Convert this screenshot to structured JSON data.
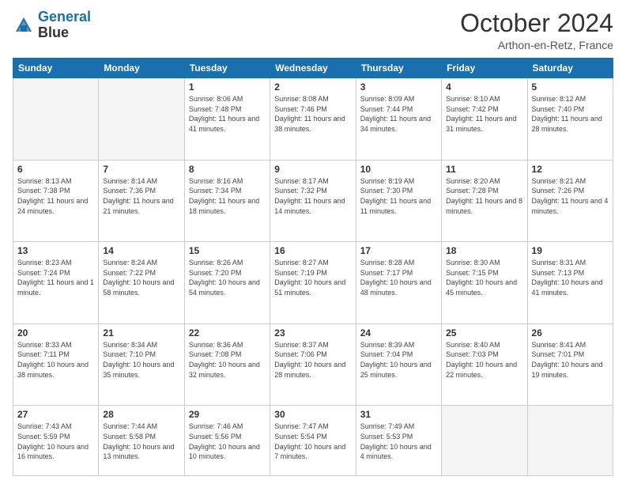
{
  "header": {
    "logo_line1": "General",
    "logo_line2": "Blue",
    "month": "October 2024",
    "location": "Arthon-en-Retz, France"
  },
  "weekdays": [
    "Sunday",
    "Monday",
    "Tuesday",
    "Wednesday",
    "Thursday",
    "Friday",
    "Saturday"
  ],
  "weeks": [
    [
      {
        "day": null
      },
      {
        "day": null
      },
      {
        "day": "1",
        "sunrise": "Sunrise: 8:06 AM",
        "sunset": "Sunset: 7:48 PM",
        "daylight": "Daylight: 11 hours and 41 minutes."
      },
      {
        "day": "2",
        "sunrise": "Sunrise: 8:08 AM",
        "sunset": "Sunset: 7:46 PM",
        "daylight": "Daylight: 11 hours and 38 minutes."
      },
      {
        "day": "3",
        "sunrise": "Sunrise: 8:09 AM",
        "sunset": "Sunset: 7:44 PM",
        "daylight": "Daylight: 11 hours and 34 minutes."
      },
      {
        "day": "4",
        "sunrise": "Sunrise: 8:10 AM",
        "sunset": "Sunset: 7:42 PM",
        "daylight": "Daylight: 11 hours and 31 minutes."
      },
      {
        "day": "5",
        "sunrise": "Sunrise: 8:12 AM",
        "sunset": "Sunset: 7:40 PM",
        "daylight": "Daylight: 11 hours and 28 minutes."
      }
    ],
    [
      {
        "day": "6",
        "sunrise": "Sunrise: 8:13 AM",
        "sunset": "Sunset: 7:38 PM",
        "daylight": "Daylight: 11 hours and 24 minutes."
      },
      {
        "day": "7",
        "sunrise": "Sunrise: 8:14 AM",
        "sunset": "Sunset: 7:36 PM",
        "daylight": "Daylight: 11 hours and 21 minutes."
      },
      {
        "day": "8",
        "sunrise": "Sunrise: 8:16 AM",
        "sunset": "Sunset: 7:34 PM",
        "daylight": "Daylight: 11 hours and 18 minutes."
      },
      {
        "day": "9",
        "sunrise": "Sunrise: 8:17 AM",
        "sunset": "Sunset: 7:32 PM",
        "daylight": "Daylight: 11 hours and 14 minutes."
      },
      {
        "day": "10",
        "sunrise": "Sunrise: 8:19 AM",
        "sunset": "Sunset: 7:30 PM",
        "daylight": "Daylight: 11 hours and 11 minutes."
      },
      {
        "day": "11",
        "sunrise": "Sunrise: 8:20 AM",
        "sunset": "Sunset: 7:28 PM",
        "daylight": "Daylight: 11 hours and 8 minutes."
      },
      {
        "day": "12",
        "sunrise": "Sunrise: 8:21 AM",
        "sunset": "Sunset: 7:26 PM",
        "daylight": "Daylight: 11 hours and 4 minutes."
      }
    ],
    [
      {
        "day": "13",
        "sunrise": "Sunrise: 8:23 AM",
        "sunset": "Sunset: 7:24 PM",
        "daylight": "Daylight: 11 hours and 1 minute."
      },
      {
        "day": "14",
        "sunrise": "Sunrise: 8:24 AM",
        "sunset": "Sunset: 7:22 PM",
        "daylight": "Daylight: 10 hours and 58 minutes."
      },
      {
        "day": "15",
        "sunrise": "Sunrise: 8:26 AM",
        "sunset": "Sunset: 7:20 PM",
        "daylight": "Daylight: 10 hours and 54 minutes."
      },
      {
        "day": "16",
        "sunrise": "Sunrise: 8:27 AM",
        "sunset": "Sunset: 7:19 PM",
        "daylight": "Daylight: 10 hours and 51 minutes."
      },
      {
        "day": "17",
        "sunrise": "Sunrise: 8:28 AM",
        "sunset": "Sunset: 7:17 PM",
        "daylight": "Daylight: 10 hours and 48 minutes."
      },
      {
        "day": "18",
        "sunrise": "Sunrise: 8:30 AM",
        "sunset": "Sunset: 7:15 PM",
        "daylight": "Daylight: 10 hours and 45 minutes."
      },
      {
        "day": "19",
        "sunrise": "Sunrise: 8:31 AM",
        "sunset": "Sunset: 7:13 PM",
        "daylight": "Daylight: 10 hours and 41 minutes."
      }
    ],
    [
      {
        "day": "20",
        "sunrise": "Sunrise: 8:33 AM",
        "sunset": "Sunset: 7:11 PM",
        "daylight": "Daylight: 10 hours and 38 minutes."
      },
      {
        "day": "21",
        "sunrise": "Sunrise: 8:34 AM",
        "sunset": "Sunset: 7:10 PM",
        "daylight": "Daylight: 10 hours and 35 minutes."
      },
      {
        "day": "22",
        "sunrise": "Sunrise: 8:36 AM",
        "sunset": "Sunset: 7:08 PM",
        "daylight": "Daylight: 10 hours and 32 minutes."
      },
      {
        "day": "23",
        "sunrise": "Sunrise: 8:37 AM",
        "sunset": "Sunset: 7:06 PM",
        "daylight": "Daylight: 10 hours and 28 minutes."
      },
      {
        "day": "24",
        "sunrise": "Sunrise: 8:39 AM",
        "sunset": "Sunset: 7:04 PM",
        "daylight": "Daylight: 10 hours and 25 minutes."
      },
      {
        "day": "25",
        "sunrise": "Sunrise: 8:40 AM",
        "sunset": "Sunset: 7:03 PM",
        "daylight": "Daylight: 10 hours and 22 minutes."
      },
      {
        "day": "26",
        "sunrise": "Sunrise: 8:41 AM",
        "sunset": "Sunset: 7:01 PM",
        "daylight": "Daylight: 10 hours and 19 minutes."
      }
    ],
    [
      {
        "day": "27",
        "sunrise": "Sunrise: 7:43 AM",
        "sunset": "Sunset: 5:59 PM",
        "daylight": "Daylight: 10 hours and 16 minutes."
      },
      {
        "day": "28",
        "sunrise": "Sunrise: 7:44 AM",
        "sunset": "Sunset: 5:58 PM",
        "daylight": "Daylight: 10 hours and 13 minutes."
      },
      {
        "day": "29",
        "sunrise": "Sunrise: 7:46 AM",
        "sunset": "Sunset: 5:56 PM",
        "daylight": "Daylight: 10 hours and 10 minutes."
      },
      {
        "day": "30",
        "sunrise": "Sunrise: 7:47 AM",
        "sunset": "Sunset: 5:54 PM",
        "daylight": "Daylight: 10 hours and 7 minutes."
      },
      {
        "day": "31",
        "sunrise": "Sunrise: 7:49 AM",
        "sunset": "Sunset: 5:53 PM",
        "daylight": "Daylight: 10 hours and 4 minutes."
      },
      {
        "day": null
      },
      {
        "day": null
      }
    ]
  ]
}
